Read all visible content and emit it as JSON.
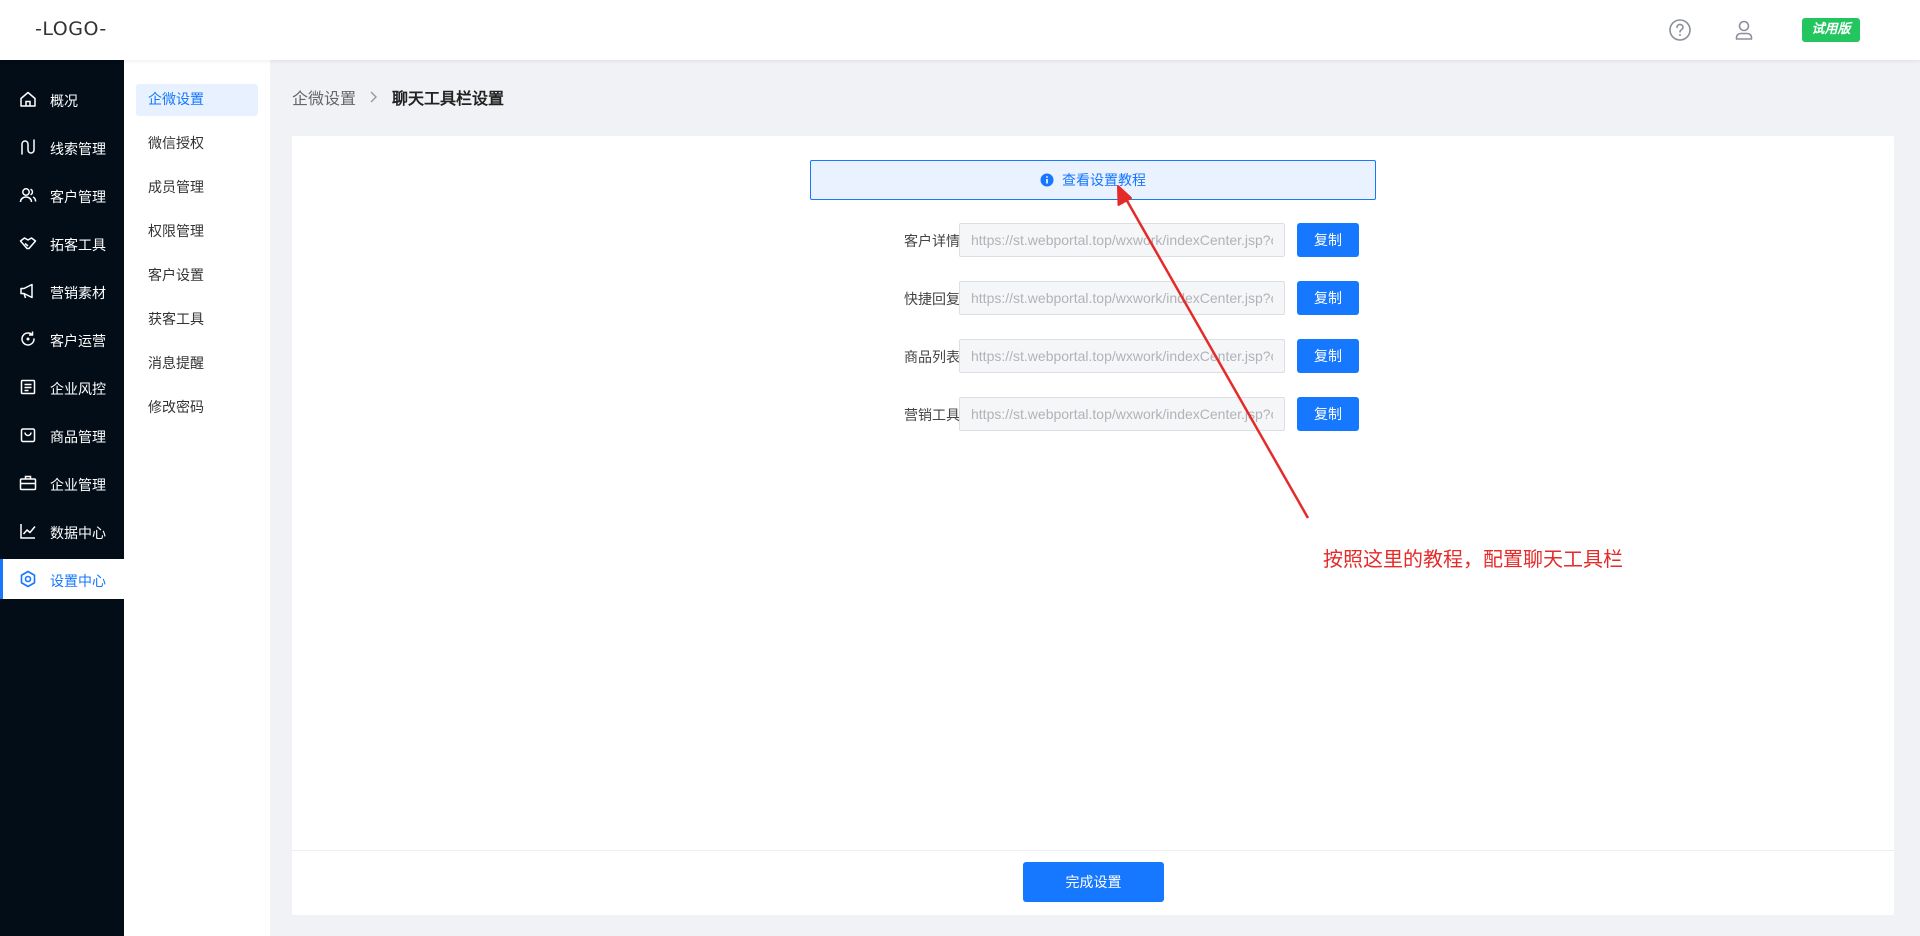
{
  "header": {
    "logo": "-LOGO-",
    "help_icon": "help-circle-icon",
    "user_icon": "user-icon",
    "trial_badge": "试用版",
    "trial_color": "#22c55e"
  },
  "sidebar": {
    "items": [
      {
        "label": "概况",
        "icon": "home-icon"
      },
      {
        "label": "线索管理",
        "icon": "route-icon"
      },
      {
        "label": "客户管理",
        "icon": "users-icon"
      },
      {
        "label": "拓客工具",
        "icon": "handshake-icon"
      },
      {
        "label": "营销素材",
        "icon": "megaphone-icon"
      },
      {
        "label": "客户运营",
        "icon": "refresh-icon"
      },
      {
        "label": "企业风控",
        "icon": "document-icon"
      },
      {
        "label": "商品管理",
        "icon": "shopping-bag-icon"
      },
      {
        "label": "企业管理",
        "icon": "briefcase-icon"
      },
      {
        "label": "数据中心",
        "icon": "chart-line-icon"
      },
      {
        "label": "设置中心",
        "icon": "settings-icon",
        "active": true
      }
    ],
    "background": "#030d18",
    "active_color": "#1677ff"
  },
  "subnav": {
    "items": [
      "企微设置",
      "微信授权",
      "成员管理",
      "权限管理",
      "客户设置",
      "获客工具",
      "消息提醒",
      "修改密码"
    ],
    "active": "企微设置"
  },
  "breadcrumb": {
    "parent": "企微设置",
    "current": "聊天工具栏设置"
  },
  "main": {
    "tutorial_link": "查看设置教程",
    "rows": [
      {
        "label": "客户详情",
        "url": "https://st.webportal.top/wxwork/indexCenter.jsp?c",
        "copy": "复制"
      },
      {
        "label": "快捷回复",
        "url": "https://st.webportal.top/wxwork/indexCenter.jsp?c",
        "copy": "复制"
      },
      {
        "label": "商品列表",
        "url": "https://st.webportal.top/wxwork/indexCenter.jsp?c",
        "copy": "复制"
      },
      {
        "label": "营销工具",
        "url": "https://st.webportal.top/wxwork/indexCenter.jsp?c",
        "copy": "复制"
      }
    ],
    "done_button": "完成设置",
    "primary_color": "#1677ff"
  },
  "annotation": {
    "text": "按照这里的教程，配置聊天工具栏",
    "color": "#e52a2a"
  }
}
